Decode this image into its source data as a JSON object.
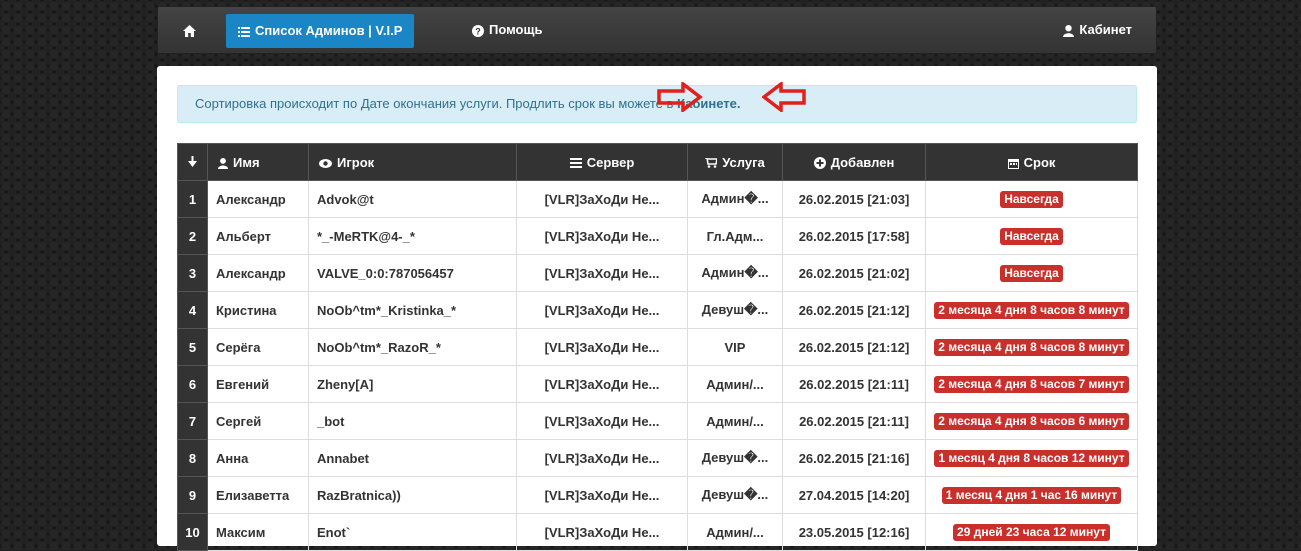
{
  "navbar": {
    "home_icon": "home-icon",
    "active_tab": "Список Админов | V.I.P",
    "help": "Помощь",
    "cabinet": "Кабинет"
  },
  "alert": {
    "text": "Сортировка происходит по Дате окончания услуги. Продлить срок вы можете в ",
    "link": "Кабинете."
  },
  "columns": {
    "num": "",
    "name": "Имя",
    "player": "Игрок",
    "server": "Сервер",
    "service": "Услуга",
    "added": "Добавлен",
    "term": "Срок"
  },
  "rows": [
    {
      "num": "1",
      "name": "Александр",
      "player": "Advok@t",
      "server": "[VLR]ЗаХоДи Не...",
      "service": "Админ�...",
      "added": "26.02.2015 [21:03]",
      "term": "Навсегда"
    },
    {
      "num": "2",
      "name": "Альберт",
      "player": "*_-MeRTK@4-_*",
      "server": "[VLR]ЗаХоДи Не...",
      "service": "Гл.Адм...",
      "added": "26.02.2015 [17:58]",
      "term": "Навсегда"
    },
    {
      "num": "3",
      "name": "Александр",
      "player": "VALVE_0:0:787056457",
      "server": "[VLR]ЗаХоДи Не...",
      "service": "Админ�...",
      "added": "26.02.2015 [21:02]",
      "term": "Навсегда"
    },
    {
      "num": "4",
      "name": "Кристина",
      "player": "NoOb^tm*_Kristinka_*",
      "server": "[VLR]ЗаХоДи Не...",
      "service": "Девуш�...",
      "added": "26.02.2015 [21:12]",
      "term": "2 месяца 4 дня 8 часов 8 минут"
    },
    {
      "num": "5",
      "name": "Серёга",
      "player": "NoOb^tm*_RazoR_*",
      "server": "[VLR]ЗаХоДи Не...",
      "service": "VIP",
      "added": "26.02.2015 [21:12]",
      "term": "2 месяца 4 дня 8 часов 8 минут"
    },
    {
      "num": "6",
      "name": "Евгений",
      "player": "Zheny[A]",
      "server": "[VLR]ЗаХоДи Не...",
      "service": "Админ/...",
      "added": "26.02.2015 [21:11]",
      "term": "2 месяца 4 дня 8 часов 7 минут"
    },
    {
      "num": "7",
      "name": "Сергей",
      "player": "_bot",
      "server": "[VLR]ЗаХоДи Не...",
      "service": "Админ/...",
      "added": "26.02.2015 [21:11]",
      "term": "2 месяца 4 дня 8 часов 6 минут"
    },
    {
      "num": "8",
      "name": "Анна",
      "player": "Annabet",
      "server": "[VLR]ЗаХоДи Не...",
      "service": "Девуш�...",
      "added": "26.02.2015 [21:16]",
      "term": "1 месяц 4 дня 8 часов 12 минут"
    },
    {
      "num": "9",
      "name": "Елизаветта",
      "player": "RazBratnica))",
      "server": "[VLR]ЗаХоДи Не...",
      "service": "Девуш�...",
      "added": "27.04.2015 [14:20]",
      "term": "1 месяц 4 дня 1 час 16 минут"
    },
    {
      "num": "10",
      "name": "Максим",
      "player": "Enot`",
      "server": "[VLR]ЗаХоДи Не...",
      "service": "Админ/...",
      "added": "23.05.2015 [12:16]",
      "term": "29 дней 23 часа 12 минут"
    }
  ],
  "colors": {
    "navbar_bg": "#3a3a3a",
    "active_tab": "#1b86c6",
    "badge": "#c9302c",
    "alert_bg": "#d9edf7",
    "alert_text": "#31708f",
    "arrow": "#e0201b"
  }
}
